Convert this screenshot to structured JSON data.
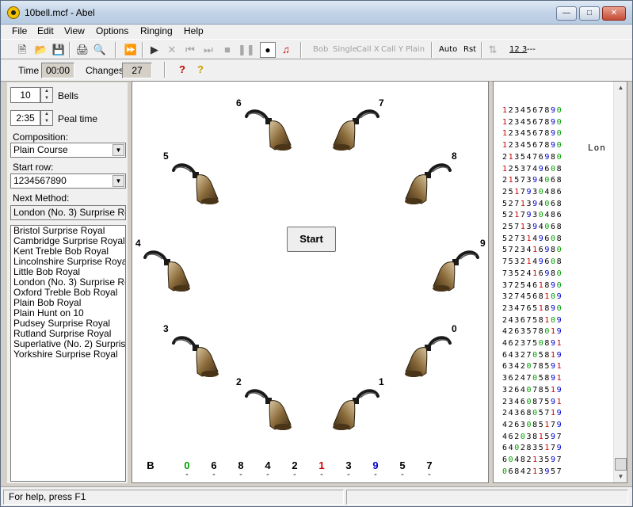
{
  "window": {
    "title": "10bell.mcf - Abel"
  },
  "menu": [
    "File",
    "Edit",
    "View",
    "Options",
    "Ringing",
    "Help"
  ],
  "toolbar": {
    "call_labels": [
      "Bob",
      "Single",
      "Call X",
      "Call Y",
      "Plain"
    ],
    "auto_label": "Auto",
    "rst_label": "Rst",
    "extra_label": "12 3",
    "dash_label": "---"
  },
  "toolbar2": {
    "time_label": "Time",
    "time_value": "00:00",
    "changes_label": "Changes",
    "changes_value": "27"
  },
  "left": {
    "bells_value": "10",
    "bells_label": "Bells",
    "peal_value": "2:35",
    "peal_label": "Peal time",
    "composition_label": "Composition:",
    "composition_value": "Plain Course",
    "start_row_label": "Start row:",
    "start_row_value": "1234567890",
    "next_method_label": "Next Method:",
    "next_method_value": "London (No. 3) Surprise Royal",
    "methods": [
      "Bristol Surprise Royal",
      "Cambridge Surprise Royal",
      "Kent Treble Bob Royal",
      "Lincolnshire Surprise Royal",
      "Little Bob Royal",
      "London (No. 3) Surprise Royal",
      "Oxford Treble Bob Royal",
      "Plain Bob Royal",
      "Plain Hunt on 10",
      "Pudsey Surprise Royal",
      "Rutland Surprise Royal",
      "Superlative (No. 2) Surprise Royal",
      "Yorkshire Surprise Royal"
    ]
  },
  "center": {
    "start_label": "Start",
    "bell_labels": [
      "6",
      "7",
      "5",
      "8",
      "4",
      "9",
      "3",
      "0",
      "2",
      "1"
    ],
    "bottom_row": [
      "B",
      "0",
      "6",
      "8",
      "4",
      "2",
      "1",
      "3",
      "9",
      "5",
      "7"
    ],
    "dash": "-",
    "colors": {
      "treble": "#cc0000",
      "observed": "#0000cc",
      "ten": "#00a000"
    }
  },
  "right": {
    "method_label": "Lon",
    "rows": [
      "1234567890",
      "1234567890",
      "1234567890",
      "1234567890",
      "2135476980",
      "1253749608",
      "2157394068",
      "2517930486",
      "5271394068",
      "5217930486",
      "2571394068",
      "5273149608",
      "5723416980",
      "7532149608",
      "7352416980",
      "3725461890",
      "3274568109",
      "2347651890",
      "2436758109",
      "4263578019",
      "4623750891",
      "6432705819",
      "6342078591",
      "3624705891",
      "3264078519",
      "2346087591",
      "2436805719",
      "4263085179",
      "4620381597",
      "6402835179",
      "6048213597",
      "0684213957"
    ]
  },
  "status": {
    "help_text": "For help, press F1"
  }
}
